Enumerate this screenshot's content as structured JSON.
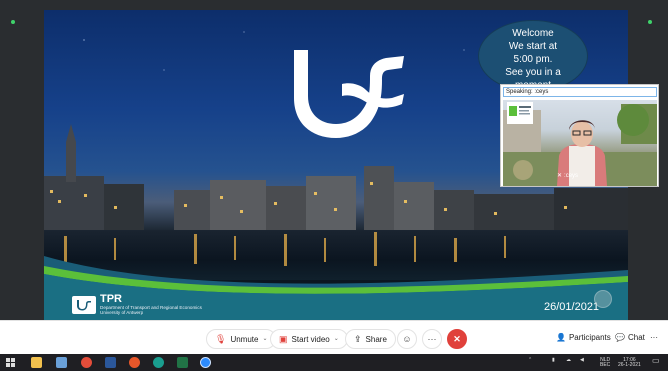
{
  "slide": {
    "date": "26/01/2021",
    "org_name": "TPR",
    "org_dept": "Department of Transport and Regional Economics",
    "org_university": "University of Antwerp"
  },
  "welcome_bubble": {
    "lines": [
      "Welcome",
      "We start at",
      "5:00 pm.",
      "See you in a",
      "moment"
    ]
  },
  "speaker": {
    "label": "Speaking: :ceys",
    "name": ":ceys",
    "badge": "Universiteit Antwerpen"
  },
  "toolbar": {
    "unmute": "Unmute",
    "start_video": "Start video",
    "share": "Share",
    "participants": "Participants",
    "chat": "Chat",
    "more": "···"
  },
  "taskbar": {
    "language": "NLD",
    "language_sub": "BEC",
    "time": "17:06",
    "date": "26-1-2021"
  },
  "colors": {
    "end_call": "#e0413b",
    "slide_sky": "#16418a",
    "accent_green": "#5bbf3a"
  }
}
